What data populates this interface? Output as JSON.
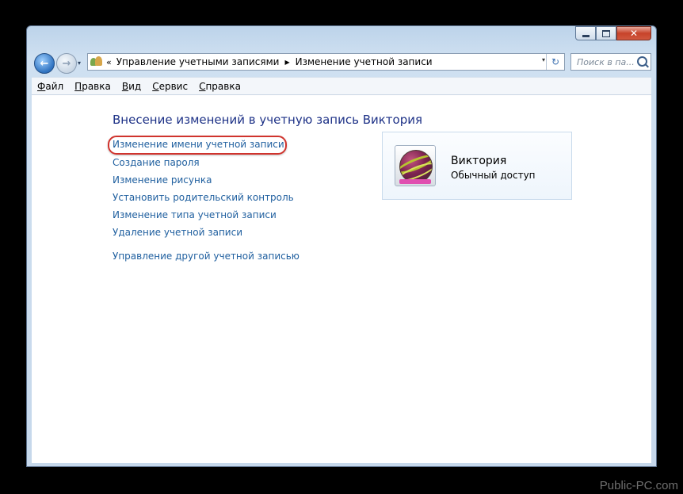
{
  "window": {
    "minimize_glyph": "minimize-icon",
    "maximize_glyph": "maximize-icon",
    "close_label": "✕"
  },
  "navigation": {
    "back_glyph": "←",
    "forward_glyph": "→",
    "dropdown_glyph": "▾"
  },
  "address": {
    "chevron": "«",
    "breadcrumbs": [
      "Управление учетными записями",
      "Изменение учетной записи"
    ],
    "separator": "▶",
    "dropdown_glyph": "▾",
    "refresh_glyph": "↻"
  },
  "search": {
    "placeholder": "Поиск в па..."
  },
  "menu": {
    "items": [
      {
        "accel": "Ф",
        "rest": "айл"
      },
      {
        "accel": "П",
        "rest": "равка"
      },
      {
        "accel": "В",
        "rest": "ид"
      },
      {
        "accel": "С",
        "rest": "ервис"
      },
      {
        "accel": "С",
        "rest": "правка"
      }
    ]
  },
  "content": {
    "title": "Внесение изменений в учетную запись Виктория",
    "tasks": [
      "Изменение имени учетной записи",
      "Создание пароля",
      "Изменение рисунка",
      "Установить родительский контроль",
      "Изменение типа учетной записи",
      "Удаление учетной записи"
    ],
    "other_account_link": "Управление другой учетной записью"
  },
  "user": {
    "name": "Виктория",
    "account_type": "Обычный доступ",
    "avatar_icon": "ball-avatar-icon"
  },
  "colors": {
    "link": "#1f5f9f",
    "title": "#1e3287",
    "highlight": "#d0332d"
  },
  "watermark": "Public-PC.com"
}
